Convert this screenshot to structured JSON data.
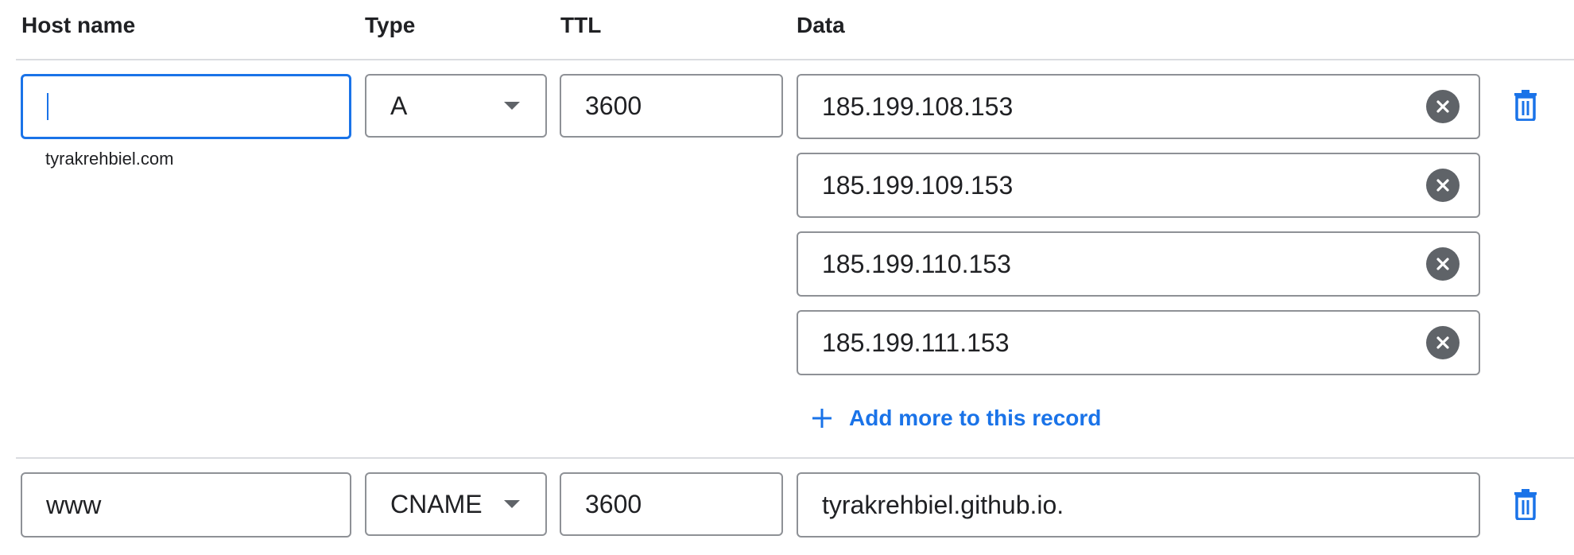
{
  "headers": {
    "host_name": "Host name",
    "type": "Type",
    "ttl": "TTL",
    "data": "Data"
  },
  "records": [
    {
      "host": "",
      "host_hint": "tyrakrehbiel.com",
      "type": "A",
      "ttl": "3600",
      "data": [
        "185.199.108.153",
        "185.199.109.153",
        "185.199.110.153",
        "185.199.111.153"
      ],
      "add_more_label": "Add more to this record"
    },
    {
      "host": "www",
      "type": "CNAME",
      "ttl": "3600",
      "data": [
        "tyrakrehbiel.github.io."
      ]
    }
  ],
  "icons": {
    "clear": "close-circle-icon",
    "delete": "trash-icon",
    "add": "plus-icon",
    "dropdown": "chevron-down-icon"
  },
  "colors": {
    "accent": "#1a73e8",
    "border": "#8e9196",
    "divider": "#dadce0",
    "icon_gray": "#5f6368"
  }
}
